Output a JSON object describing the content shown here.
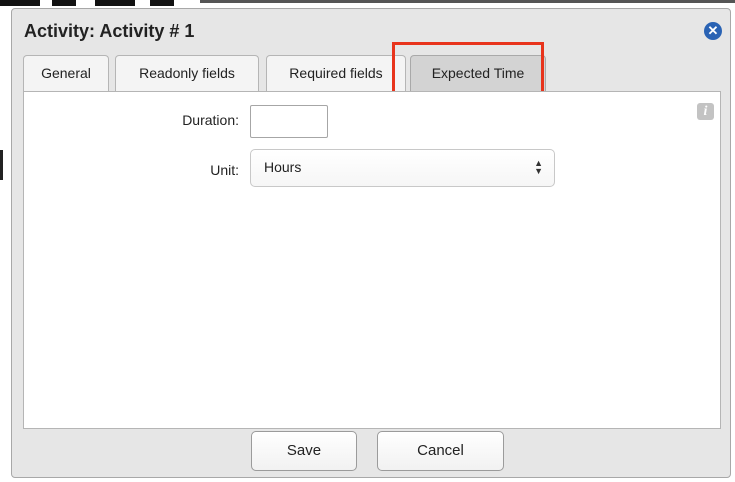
{
  "dialog": {
    "title": "Activity: Activity # 1",
    "close_icon": "close-circle-icon",
    "accent_color": "#2a63b4",
    "highlight_color": "#e8341c"
  },
  "tabs": [
    {
      "label": "General",
      "active": false
    },
    {
      "label": "Readonly fields",
      "active": false
    },
    {
      "label": "Required fields",
      "active": false
    },
    {
      "label": "Expected Time",
      "active": true
    }
  ],
  "form": {
    "duration_label": "Duration:",
    "duration_value": "",
    "unit_label": "Unit:",
    "unit_selected": "Hours",
    "info_icon": "info-icon"
  },
  "buttons": {
    "save": "Save",
    "cancel": "Cancel"
  }
}
